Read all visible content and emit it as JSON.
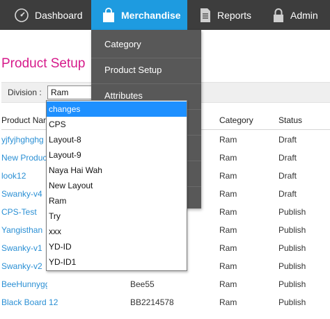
{
  "nav": {
    "items": [
      {
        "label": "Dashboard",
        "icon": "speedometer-icon"
      },
      {
        "label": "Merchandise",
        "icon": "shopping-bag-icon"
      },
      {
        "label": "Reports",
        "icon": "document-icon"
      },
      {
        "label": "Admin",
        "icon": "lock-icon"
      }
    ],
    "active": "Merchandise",
    "colors": {
      "bar": "#3d3d3d",
      "active": "#1e9be0",
      "submenu": "#585858"
    }
  },
  "merch_menu": {
    "items": [
      "Category",
      "Product Setup",
      "Attributes"
    ]
  },
  "page": {
    "title": "Product Setup",
    "title_color": "#d6198a"
  },
  "division": {
    "label": "Division :",
    "value": "Ram",
    "options": [
      "changes",
      "CPS",
      "Layout-8",
      "Layout-9",
      "Naya Hai Wah",
      "New Layout",
      "Ram",
      "Try",
      "xxx",
      "YD-ID",
      "YD-ID1"
    ],
    "highlighted": "changes"
  },
  "table": {
    "headers": {
      "name": "Product Nar",
      "category": "Category",
      "status": "Status"
    },
    "rows": [
      {
        "name": "yjfyjhghghg",
        "code": "",
        "category": "Ram",
        "status": "Draft"
      },
      {
        "name": "New Product",
        "code": "",
        "category": "Ram",
        "status": "Draft"
      },
      {
        "name": "look12",
        "code": "",
        "category": "Ram",
        "status": "Draft"
      },
      {
        "name": "Swanky-v4",
        "code": "",
        "category": "Ram",
        "status": "Draft"
      },
      {
        "name": "CPS-Test",
        "code": "",
        "category": "Ram",
        "status": "Publish"
      },
      {
        "name": "Yangisthan",
        "code": "",
        "category": "Ram",
        "status": "Publish"
      },
      {
        "name": "Swanky-v1",
        "code": "",
        "category": "Ram",
        "status": "Publish"
      },
      {
        "name": "Swanky-v2",
        "code": "",
        "category": "Ram",
        "status": "Publish"
      },
      {
        "name": "BeeHunnygg",
        "code": "Bee55",
        "category": "Ram",
        "status": "Publish"
      },
      {
        "name": "Black Board 12",
        "code": "BB2214578",
        "category": "Ram",
        "status": "Publish"
      }
    ]
  }
}
